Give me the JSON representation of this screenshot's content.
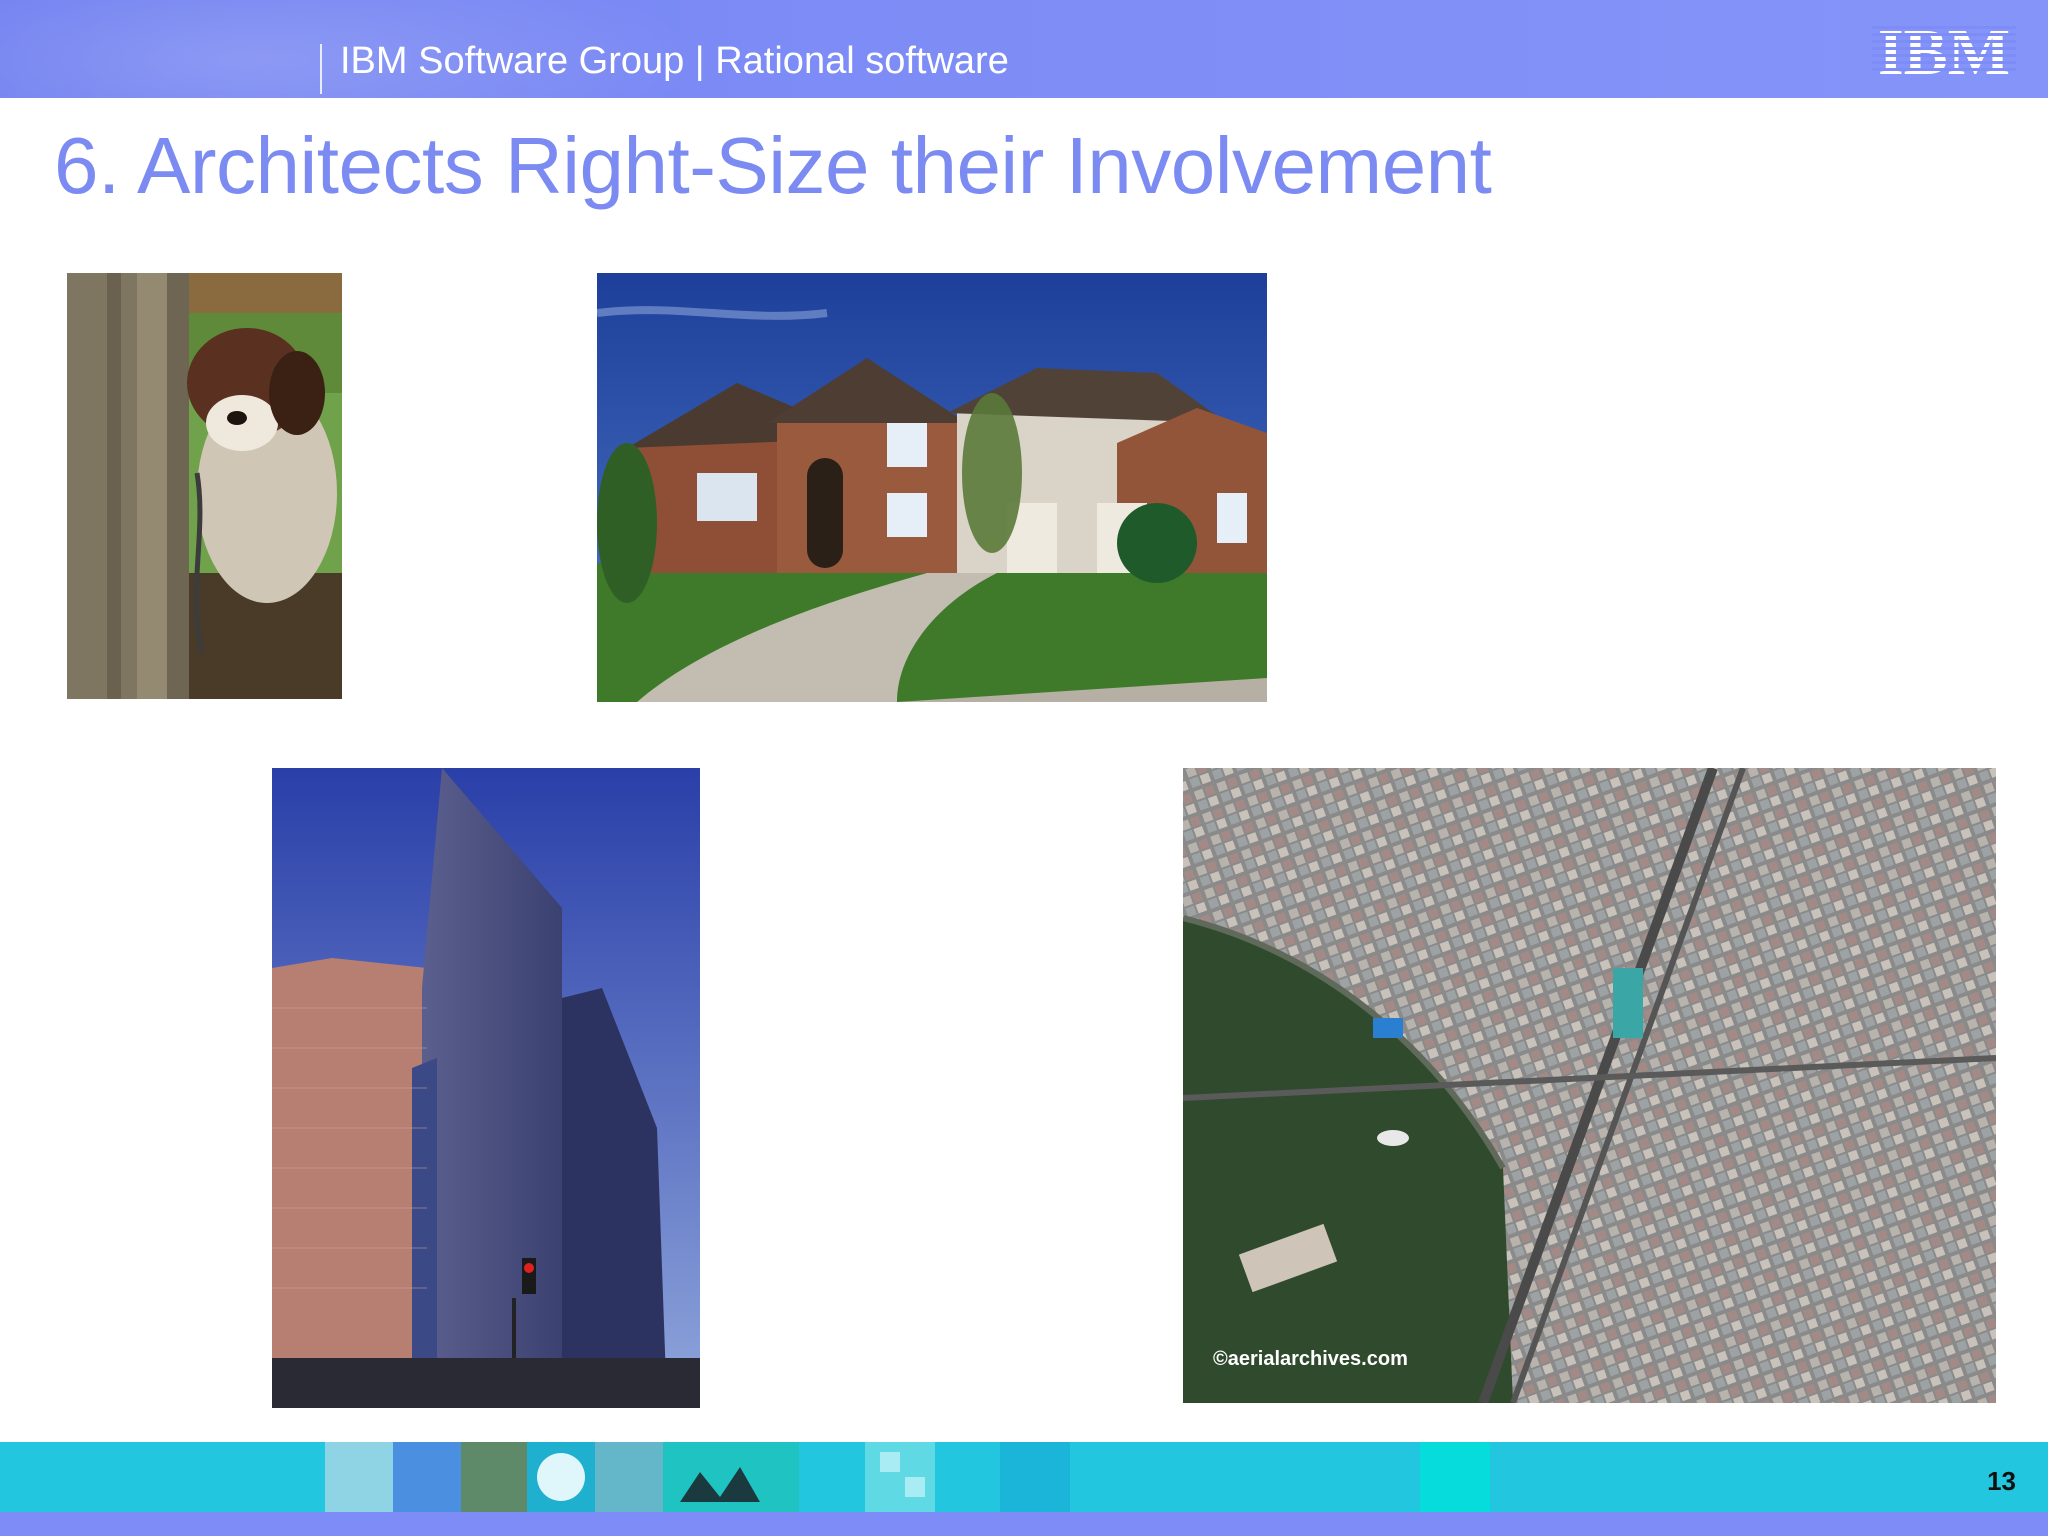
{
  "header": {
    "title": "IBM Software Group | Rational software",
    "logo": "IBM",
    "colors": {
      "bar": "#7d8cf6",
      "text": "#ffffff"
    }
  },
  "slide": {
    "title": "6. Architects Right-Size their Involvement",
    "title_color": "#7b8bf2"
  },
  "photos": [
    {
      "subject": "dog-by-doghouse"
    },
    {
      "subject": "suburban-house"
    },
    {
      "subject": "skyscrapers"
    },
    {
      "subject": "aerial-city",
      "caption": "©aerialarchives.com"
    }
  ],
  "footer": {
    "page_number": "13",
    "colors": {
      "strip": "#22c6df",
      "band": "#7d8cf6"
    }
  }
}
